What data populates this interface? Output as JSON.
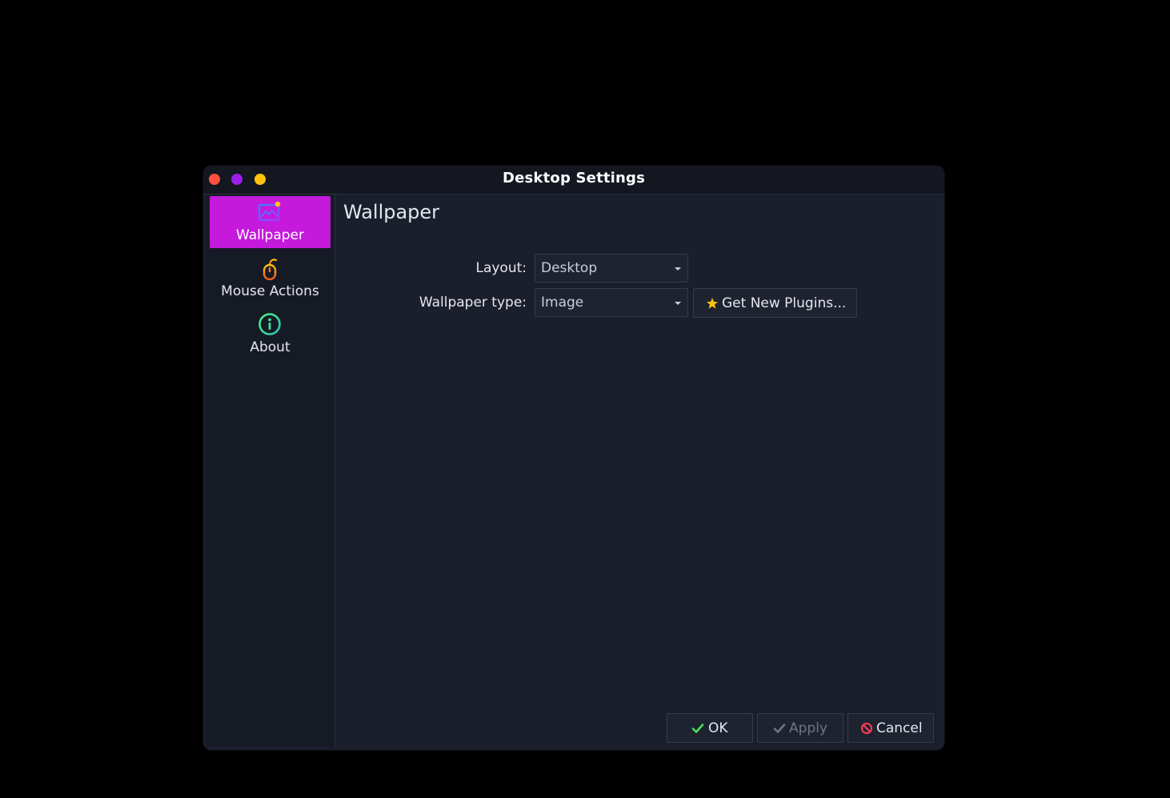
{
  "window": {
    "title": "Desktop Settings",
    "controls": {
      "close_color": "#ff4f3f",
      "maximize_color": "#9b1fe8",
      "minimize_color": "#ffc30e"
    }
  },
  "sidebar": {
    "items": [
      {
        "label": "Wallpaper",
        "icon": "wallpaper-icon",
        "active": true
      },
      {
        "label": "Mouse Actions",
        "icon": "mouse-icon",
        "active": false
      },
      {
        "label": "About",
        "icon": "info-icon",
        "active": false
      }
    ],
    "active_color": "#c519dc"
  },
  "main": {
    "heading": "Wallpaper",
    "layout": {
      "label": "Layout:",
      "value": "Desktop"
    },
    "wallpaper_type": {
      "label": "Wallpaper type:",
      "value": "Image"
    },
    "plugins_button": {
      "label": "Get New Plugins...",
      "icon": "star-icon"
    }
  },
  "footer": {
    "ok": {
      "label": "OK",
      "icon": "check-icon",
      "enabled": true
    },
    "apply": {
      "label": "Apply",
      "icon": "check-icon",
      "enabled": false
    },
    "cancel": {
      "label": "Cancel",
      "icon": "cancel-icon",
      "enabled": true
    }
  }
}
